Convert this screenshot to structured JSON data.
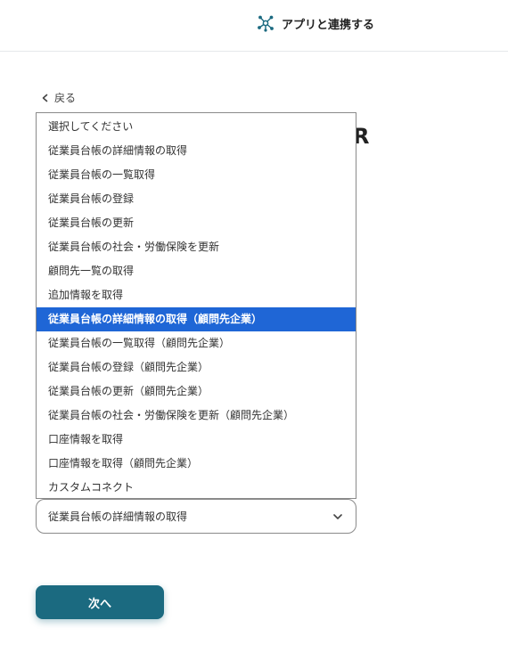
{
  "header": {
    "title": "アプリと連携する",
    "icon": "network-nodes-icon"
  },
  "back_link": {
    "label": "戻る",
    "icon": "chevron-left-icon"
  },
  "heading_fragment": "R",
  "dropdown": {
    "options": [
      "選択してください",
      "従業員台帳の詳細情報の取得",
      "従業員台帳の一覧取得",
      "従業員台帳の登録",
      "従業員台帳の更新",
      "従業員台帳の社会・労働保険を更新",
      "顧問先一覧の取得",
      "追加情報を取得",
      "従業員台帳の詳細情報の取得（顧問先企業）",
      "従業員台帳の一覧取得（顧問先企業）",
      "従業員台帳の登録（顧問先企業）",
      "従業員台帳の更新（顧問先企業）",
      "従業員台帳の社会・労働保険を更新（顧問先企業）",
      "口座情報を取得",
      "口座情報を取得（顧問先企業）",
      "カスタムコネクト"
    ],
    "highlighted_index": 8,
    "highlight_color": "#1f66d6"
  },
  "select": {
    "value": "従業員台帳の詳細情報の取得",
    "icon": "chevron-down-icon"
  },
  "next_button": {
    "label": "次へ",
    "color": "#1b6a80"
  }
}
